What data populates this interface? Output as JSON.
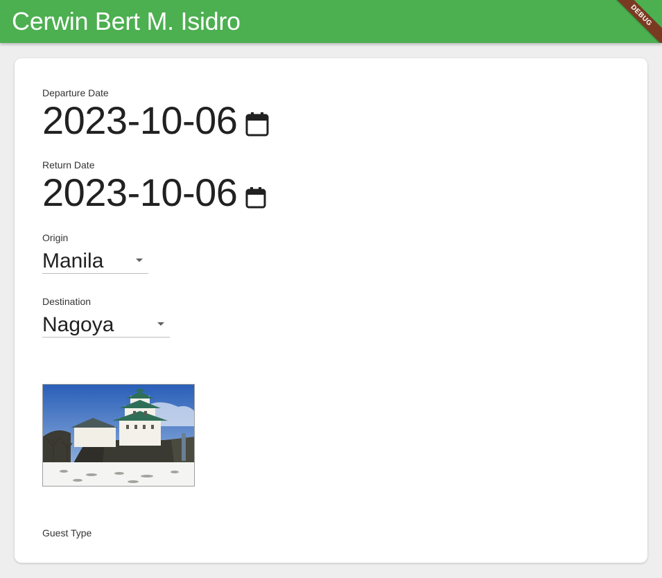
{
  "appbar": {
    "title": "Cerwin Bert M. Isidro",
    "debug_label": "DEBUG",
    "color": "#4caf50"
  },
  "form": {
    "departure": {
      "label": "Departure Date",
      "value": "2023-10-06",
      "icon": "calendar-icon"
    },
    "return": {
      "label": "Return Date",
      "value": "2023-10-06",
      "icon": "calendar-icon"
    },
    "origin": {
      "label": "Origin",
      "value": "Manila"
    },
    "destination": {
      "label": "Destination",
      "value": "Nagoya",
      "image": "nagoya-castle-image"
    },
    "guest_type": {
      "label": "Guest Type"
    }
  }
}
